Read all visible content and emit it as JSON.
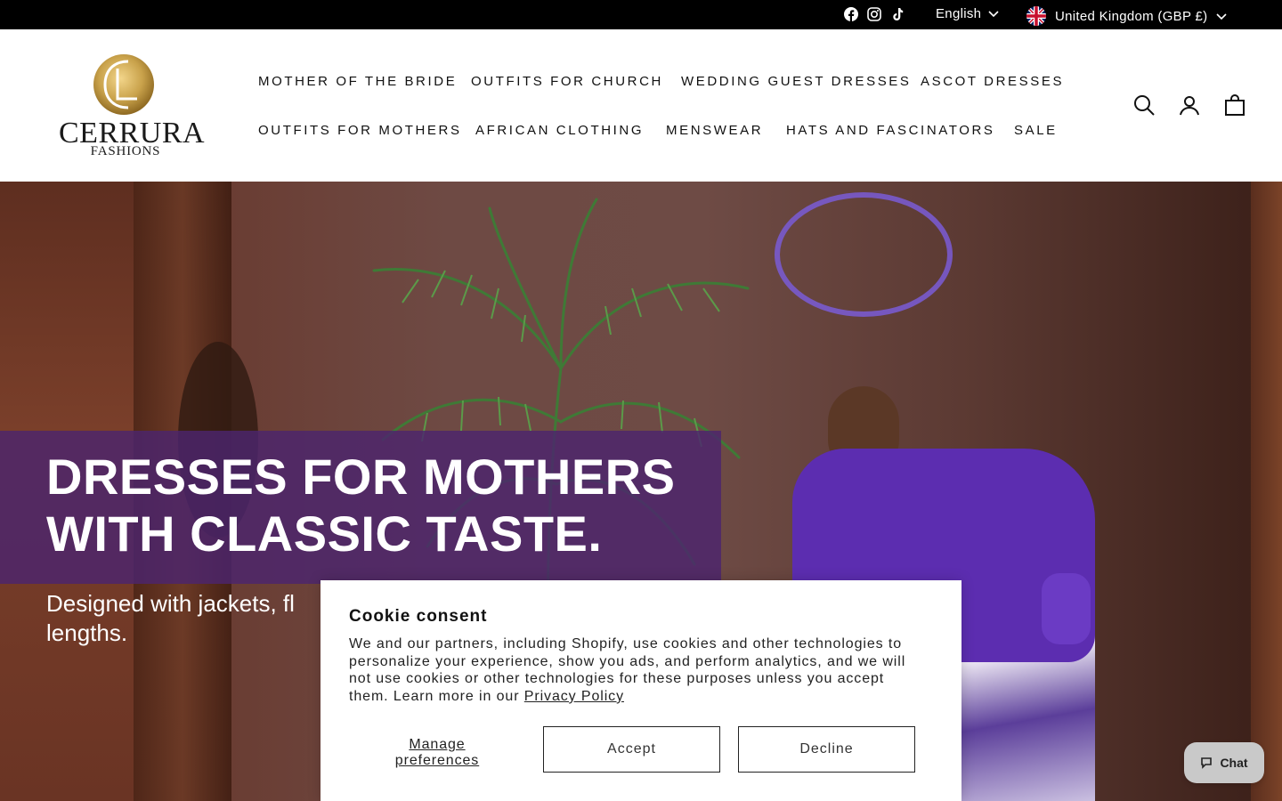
{
  "topbar": {
    "social_icons": [
      "facebook-icon",
      "instagram-icon",
      "tiktok-icon"
    ],
    "language": "English",
    "country": "United Kingdom (GBP £)"
  },
  "header": {
    "logo": {
      "name": "CERRURA",
      "sub": "FASHIONS"
    },
    "nav_row1": [
      "MOTHER OF THE BRIDE",
      "OUTFITS FOR CHURCH",
      "WEDDING GUEST DRESSES",
      "ASCOT DRESSES"
    ],
    "nav_row2": [
      "OUTFITS FOR MOTHERS",
      "AFRICAN CLOTHING",
      "MENSWEAR",
      "HATS AND FASCINATORS",
      "SALE"
    ],
    "icons": [
      "search-icon",
      "account-icon",
      "cart-icon"
    ]
  },
  "hero": {
    "title_line1": "DRESSES FOR MOTHERS",
    "title_line2": "WITH CLASSIC TASTE.",
    "subtitle_line1": "Designed with jackets, fl",
    "subtitle_line2": "lengths."
  },
  "cookie": {
    "title": "Cookie consent",
    "body": "We and our partners, including Shopify, use cookies and other technologies to personalize your experience, show you ads, and perform analytics, and we will not use cookies or other technologies for these purposes unless you accept them. Learn more in our ",
    "link": "Privacy Policy",
    "manage_line1": "Manage",
    "manage_line2": "preferences",
    "accept": "Accept",
    "decline": "Decline"
  },
  "chat": {
    "label": "Chat"
  },
  "colors": {
    "topbar_bg": "#000000",
    "hero_band": "#4c246e",
    "brand_gold": "#c9a24b"
  }
}
